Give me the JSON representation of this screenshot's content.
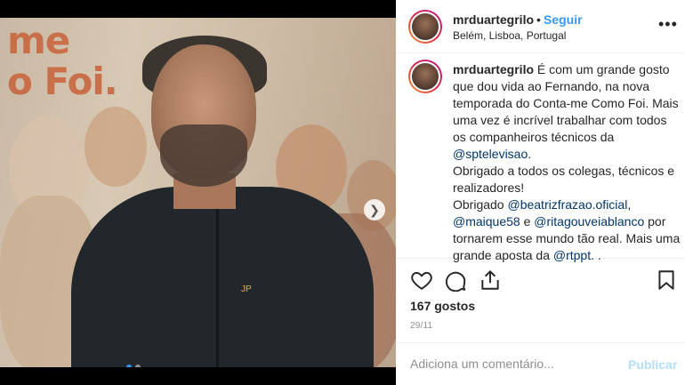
{
  "photo": {
    "background_text_line1": "me",
    "background_text_line2": "o Foi."
  },
  "post_header": {
    "username": "mrduartegrilo",
    "separator": "•",
    "follow_label": "Seguir",
    "location": "Belém, Lisboa, Portugal",
    "more_icon": "more-horizontal-icon"
  },
  "caption": {
    "username": "mrduartegrilo",
    "text_part1": " É com um grande gosto que dou vida ao Fernando, na nova temporada do Conta-me Como Foi. Mais uma vez é incrível trabalhar com todos os companheiros técnicos da ",
    "mention_sptelevisao": "@sptelevisao",
    "text_part2": ".",
    "line2": "Obrigado a todos os colegas, técnicos e realizadores!",
    "text_part3": "Obrigado ",
    "mention_beatriz": "@beatrizfrazao.oficial",
    "text_part4": ",",
    "mention_maique": "@maique58",
    "text_part5": " e ",
    "mention_rita": "@ritagouveiablanco",
    "text_part6": " por tornarem esse mundo tão real. Mais uma grande aposta da ",
    "mention_rtp": "@rtppt",
    "text_part7": ". ."
  },
  "actions": {
    "like_icon": "heart-icon",
    "comment_icon": "comment-icon",
    "share_icon": "share-icon",
    "save_icon": "bookmark-icon"
  },
  "likes_text": "167 gostos",
  "date_text": "29/11",
  "comment": {
    "placeholder": "Adiciona um comentário...",
    "publish_label": "Publicar"
  },
  "colors": {
    "link_blue": "#3897f0",
    "mention": "#003569",
    "publish_disabled": "#b2dffc"
  }
}
